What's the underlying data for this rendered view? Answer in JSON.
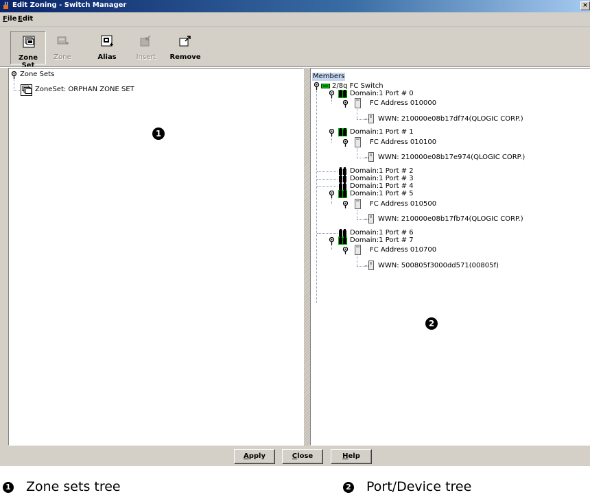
{
  "window": {
    "title": "Edit Zoning - Switch Manager",
    "close_glyph": "×"
  },
  "menu": [
    {
      "prefix": "F",
      "rest": "ile"
    },
    {
      "prefix": "E",
      "rest": "dit"
    }
  ],
  "toolbar": {
    "buttons": [
      {
        "label": "Zone Set",
        "enabled": true,
        "active": true,
        "icon": "zone-set-icon"
      },
      {
        "label": "Zone",
        "enabled": false,
        "active": false,
        "icon": "zone-icon"
      },
      {
        "label": "Alias",
        "enabled": true,
        "active": false,
        "icon": "alias-icon"
      },
      {
        "label": "Insert",
        "enabled": false,
        "active": false,
        "icon": "insert-icon"
      },
      {
        "label": "Remove",
        "enabled": true,
        "active": false,
        "icon": "remove-icon"
      }
    ]
  },
  "zone_tree": {
    "root": "Zone Sets",
    "items": [
      "ZoneSet: ORPHAN ZONE SET"
    ]
  },
  "member_tree": {
    "root": "Members",
    "switch": "2/8q FC Switch",
    "ports": [
      {
        "label": "Domain:1 Port # 0",
        "active": true,
        "fc_address": "FC Address 010000",
        "wwn": "WWN: 210000e08b17df74(QLOGIC CORP.)"
      },
      {
        "label": "Domain:1 Port # 1",
        "active": true,
        "fc_address": "FC Address 010100",
        "wwn": "WWN: 210000e08b17e974(QLOGIC CORP.)"
      },
      {
        "label": "Domain:1 Port # 2",
        "active": false
      },
      {
        "label": "Domain:1 Port # 3",
        "active": false
      },
      {
        "label": "Domain:1 Port # 4",
        "active": false
      },
      {
        "label": "Domain:1 Port # 5",
        "active": true,
        "fc_address": "FC Address 010500",
        "wwn": "WWN: 210000e08b17fb74(QLOGIC CORP.)"
      },
      {
        "label": "Domain:1 Port # 6",
        "active": false
      },
      {
        "label": "Domain:1 Port # 7",
        "active": true,
        "fc_address": "FC Address 010700",
        "wwn": "WWN: 500805f3000dd571(00805f)"
      }
    ]
  },
  "buttons": {
    "apply": {
      "prefix": "A",
      "rest": "pply"
    },
    "close": {
      "prefix": "C",
      "rest": "lose"
    },
    "help": {
      "prefix": "H",
      "rest": "elp"
    }
  },
  "callouts": [
    "1",
    "2"
  ],
  "legend": [
    "Zone sets tree",
    "Port/Device tree"
  ],
  "colors": {
    "port_active": "#00c000",
    "title_bar": "#0a246a",
    "selection": "#c5d6ef"
  }
}
